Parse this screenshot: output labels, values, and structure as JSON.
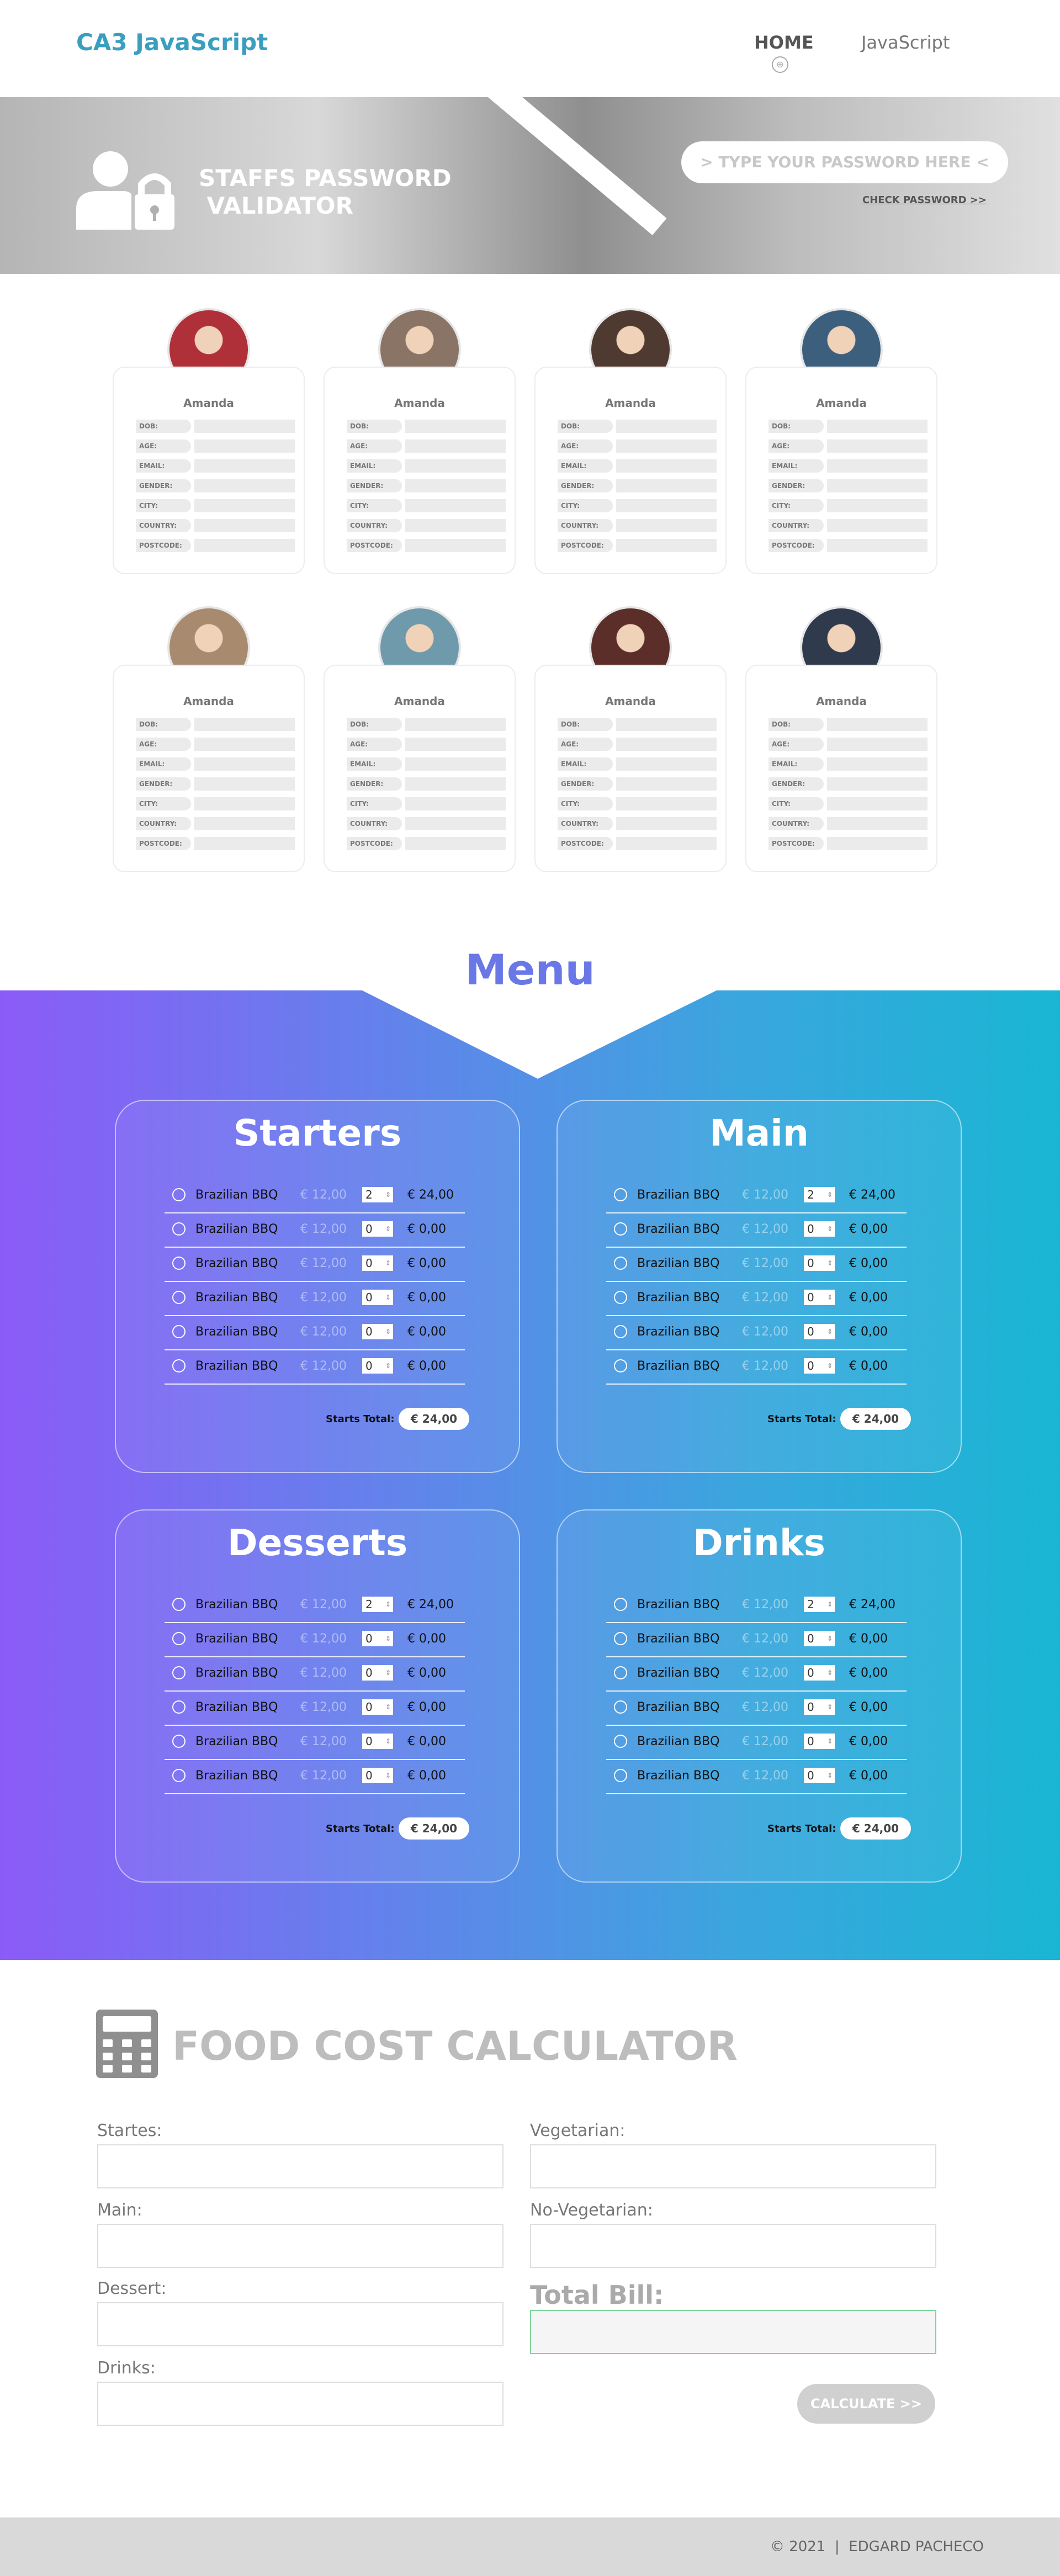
{
  "header": {
    "logo": "CA3 JavaScript",
    "nav": [
      {
        "label": "HOME",
        "active": true
      },
      {
        "label": "JavaScript",
        "active": false
      }
    ],
    "home_indicator": "⊕"
  },
  "password_banner": {
    "title_line1": "STAFFS PASSWORD",
    "title_line2": " VALIDATOR",
    "input_placeholder": "> TYPE YOUR PASSWORD HERE <",
    "check_link": "CHECK PASSWORD >>"
  },
  "staff": {
    "field_labels": [
      "DOB:",
      "AGE:",
      "EMAIL:",
      "GENDER:",
      "CITY:",
      "COUNTRY:",
      "POSTCODE:"
    ],
    "cards": [
      {
        "name": "Amanda",
        "avatar_color": "#b0303a"
      },
      {
        "name": "Amanda",
        "avatar_color": "#8a7466"
      },
      {
        "name": "Amanda",
        "avatar_color": "#4e3a30"
      },
      {
        "name": "Amanda",
        "avatar_color": "#3d5f7e"
      },
      {
        "name": "Amanda",
        "avatar_color": "#a88b6e"
      },
      {
        "name": "Amanda",
        "avatar_color": "#6e9aab"
      },
      {
        "name": "Amanda",
        "avatar_color": "#5c2e2a"
      },
      {
        "name": "Amanda",
        "avatar_color": "#2f3b4d"
      }
    ]
  },
  "menu": {
    "title": "Menu",
    "sections": [
      {
        "title": "Starters",
        "items": [
          {
            "name": "Brazilian BBQ",
            "price": "€ 12,00",
            "qty": "2",
            "total": "€ 24,00"
          },
          {
            "name": "Brazilian BBQ",
            "price": "€ 12,00",
            "qty": "0",
            "total": "€ 0,00"
          },
          {
            "name": "Brazilian BBQ",
            "price": "€ 12,00",
            "qty": "0",
            "total": "€ 0,00"
          },
          {
            "name": "Brazilian BBQ",
            "price": "€ 12,00",
            "qty": "0",
            "total": "€ 0,00"
          },
          {
            "name": "Brazilian BBQ",
            "price": "€ 12,00",
            "qty": "0",
            "total": "€ 0,00"
          },
          {
            "name": "Brazilian BBQ",
            "price": "€ 12,00",
            "qty": "0",
            "total": "€ 0,00"
          }
        ],
        "total_label": "Starts Total:",
        "total_value": "€ 24,00"
      },
      {
        "title": "Main",
        "items": [
          {
            "name": "Brazilian BBQ",
            "price": "€ 12,00",
            "qty": "2",
            "total": "€ 24,00"
          },
          {
            "name": "Brazilian BBQ",
            "price": "€ 12,00",
            "qty": "0",
            "total": "€ 0,00"
          },
          {
            "name": "Brazilian BBQ",
            "price": "€ 12,00",
            "qty": "0",
            "total": "€ 0,00"
          },
          {
            "name": "Brazilian BBQ",
            "price": "€ 12,00",
            "qty": "0",
            "total": "€ 0,00"
          },
          {
            "name": "Brazilian BBQ",
            "price": "€ 12,00",
            "qty": "0",
            "total": "€ 0,00"
          },
          {
            "name": "Brazilian BBQ",
            "price": "€ 12,00",
            "qty": "0",
            "total": "€ 0,00"
          }
        ],
        "total_label": "Starts Total:",
        "total_value": "€ 24,00"
      },
      {
        "title": "Desserts",
        "items": [
          {
            "name": "Brazilian BBQ",
            "price": "€ 12,00",
            "qty": "2",
            "total": "€ 24,00"
          },
          {
            "name": "Brazilian BBQ",
            "price": "€ 12,00",
            "qty": "0",
            "total": "€ 0,00"
          },
          {
            "name": "Brazilian BBQ",
            "price": "€ 12,00",
            "qty": "0",
            "total": "€ 0,00"
          },
          {
            "name": "Brazilian BBQ",
            "price": "€ 12,00",
            "qty": "0",
            "total": "€ 0,00"
          },
          {
            "name": "Brazilian BBQ",
            "price": "€ 12,00",
            "qty": "0",
            "total": "€ 0,00"
          },
          {
            "name": "Brazilian BBQ",
            "price": "€ 12,00",
            "qty": "0",
            "total": "€ 0,00"
          }
        ],
        "total_label": "Starts Total:",
        "total_value": "€ 24,00"
      },
      {
        "title": "Drinks",
        "items": [
          {
            "name": "Brazilian BBQ",
            "price": "€ 12,00",
            "qty": "2",
            "total": "€ 24,00"
          },
          {
            "name": "Brazilian BBQ",
            "price": "€ 12,00",
            "qty": "0",
            "total": "€ 0,00"
          },
          {
            "name": "Brazilian BBQ",
            "price": "€ 12,00",
            "qty": "0",
            "total": "€ 0,00"
          },
          {
            "name": "Brazilian BBQ",
            "price": "€ 12,00",
            "qty": "0",
            "total": "€ 0,00"
          },
          {
            "name": "Brazilian BBQ",
            "price": "€ 12,00",
            "qty": "0",
            "total": "€ 0,00"
          },
          {
            "name": "Brazilian BBQ",
            "price": "€ 12,00",
            "qty": "0",
            "total": "€ 0,00"
          }
        ],
        "total_label": "Starts Total:",
        "total_value": "€ 24,00"
      }
    ]
  },
  "calculator": {
    "title": "FOOD COST CALCULATOR",
    "fields_left": [
      {
        "label": "Startes:",
        "value": ""
      },
      {
        "label": "Main:",
        "value": ""
      },
      {
        "label": "Dessert:",
        "value": ""
      },
      {
        "label": "Drinks:",
        "value": ""
      }
    ],
    "fields_right": [
      {
        "label": "Vegetarian:",
        "value": ""
      },
      {
        "label": "No-Vegetarian:",
        "value": ""
      }
    ],
    "total_label": "Total Bill:",
    "total_value": "",
    "button_label": "CALCULATE >>"
  },
  "footer": {
    "text": "© 2021  |  EDGARD PACHECO"
  }
}
